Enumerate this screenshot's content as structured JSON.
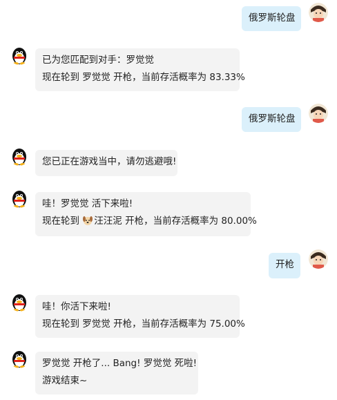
{
  "messages": [
    {
      "sender": "user",
      "lines": [
        "俄罗斯轮盘"
      ]
    },
    {
      "sender": "bot",
      "lines": [
        "已为您匹配到对手：罗觉觉",
        "现在轮到 罗觉觉 开枪，当前存活概率为 83.33%"
      ]
    },
    {
      "sender": "user",
      "lines": [
        "俄罗斯轮盘"
      ]
    },
    {
      "sender": "bot",
      "lines": [
        "您已正在游戏当中，请勿逃避哦!"
      ]
    },
    {
      "sender": "bot",
      "lines": [
        "哇！罗觉觉 活下来啦!",
        "现在轮到",
        "汪汪泥 开枪，当前存活概率为 80.00%"
      ]
    },
    {
      "sender": "user",
      "lines": [
        "开枪"
      ]
    },
    {
      "sender": "bot",
      "lines": [
        "哇！你活下来啦!",
        "现在轮到 罗觉觉 开枪，当前存活概率为 75.00%"
      ]
    },
    {
      "sender": "bot",
      "lines": [
        "罗觉觉 开枪了... Bang! 罗觉觉 死啦!",
        "游戏结束~"
      ]
    }
  ],
  "colors": {
    "bot_bubble": "#f3f3f3",
    "user_bubble": "#dbf0fb",
    "text": "#222222"
  },
  "icons": {
    "bot_avatar": "penguin-icon",
    "user_avatar": "user-photo-avatar",
    "inline": "dog-emoji-icon"
  }
}
